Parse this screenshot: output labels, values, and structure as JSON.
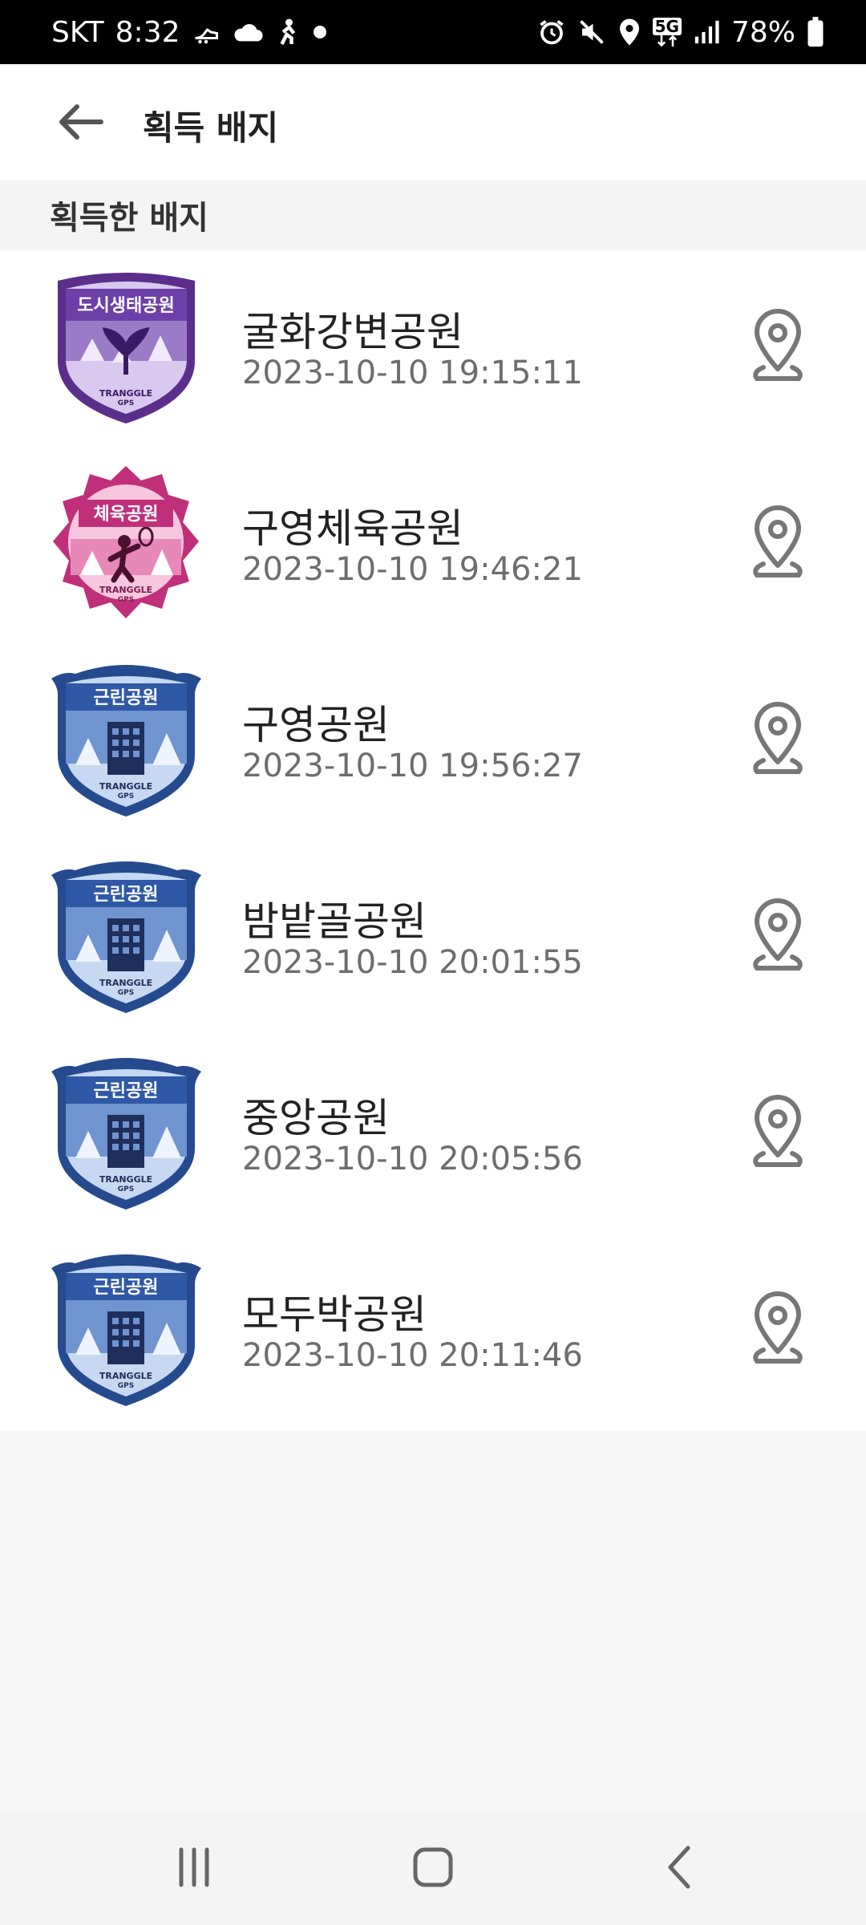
{
  "status_bar": {
    "carrier": "SKT",
    "time": "8:32",
    "network": "5G",
    "battery": "78%",
    "icons": [
      "running-shoe-icon",
      "cloud-icon",
      "activity-icon",
      "dot-icon",
      "alarm-icon",
      "mute-icon",
      "location-icon",
      "5g-icon",
      "signal-icon",
      "battery-icon"
    ]
  },
  "header": {
    "title": "획득 배지",
    "back_icon": "arrow-left-icon"
  },
  "section": {
    "title": "획득한 배지"
  },
  "badges": [
    {
      "name": "굴화강변공원",
      "time": "2023-10-10 19:15:11",
      "badge_label": "도시생태공원",
      "badge_type": "purple-shield-plant",
      "badge_brand": "TRANGGLE",
      "badge_sub": "GPS"
    },
    {
      "name": "구영체육공원",
      "time": "2023-10-10 19:46:21",
      "badge_label": "체육공원",
      "badge_type": "pink-star-sports",
      "badge_brand": "TRANGGLE",
      "badge_sub": "GPS"
    },
    {
      "name": "구영공원",
      "time": "2023-10-10 19:56:27",
      "badge_label": "근린공원",
      "badge_type": "blue-shield-building",
      "badge_brand": "TRANGGLE",
      "badge_sub": "GPS"
    },
    {
      "name": "밤밭골공원",
      "time": "2023-10-10 20:01:55",
      "badge_label": "근린공원",
      "badge_type": "blue-shield-building",
      "badge_brand": "TRANGGLE",
      "badge_sub": "GPS"
    },
    {
      "name": "중앙공원",
      "time": "2023-10-10 20:05:56",
      "badge_label": "근린공원",
      "badge_type": "blue-shield-building",
      "badge_brand": "TRANGGLE",
      "badge_sub": "GPS"
    },
    {
      "name": "모두박공원",
      "time": "2023-10-10 20:11:46",
      "badge_label": "근린공원",
      "badge_type": "blue-shield-building",
      "badge_brand": "TRANGGLE",
      "badge_sub": "GPS"
    }
  ],
  "nav_bar": {
    "icons": [
      "recent-apps-icon",
      "home-icon",
      "back-icon"
    ]
  },
  "colors": {
    "purple": "#6a3fa3",
    "pink": "#d94a93",
    "blue": "#3c5fa6",
    "icon_gray": "#777777"
  }
}
